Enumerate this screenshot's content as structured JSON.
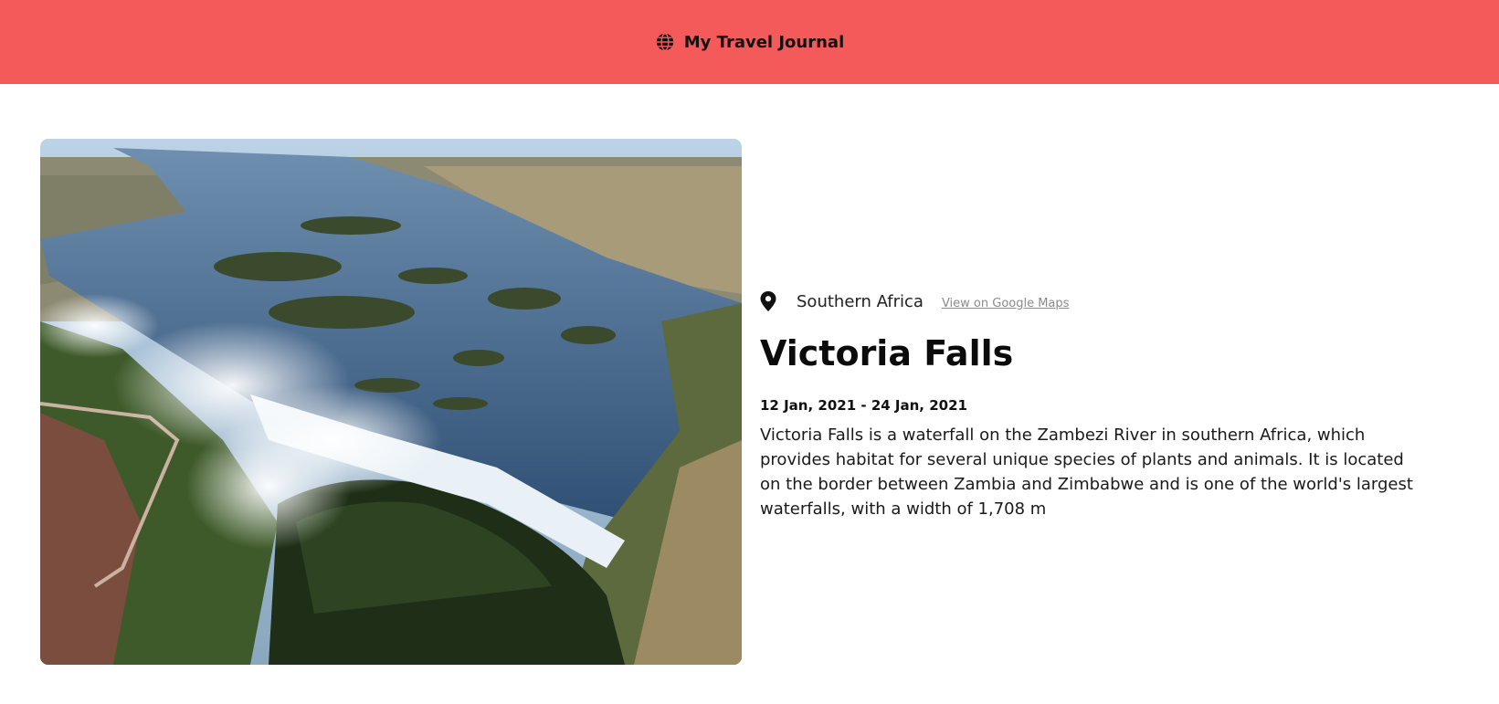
{
  "header": {
    "icon": "globe-icon",
    "title": "My Travel Journal",
    "background_color": "#f55a5a"
  },
  "entry": {
    "image_alt": "Victoria Falls",
    "location_icon": "map-pin-icon",
    "location": "Southern Africa",
    "maps_link_label": "View on Google Maps",
    "title": "Victoria Falls",
    "dates": "12 Jan, 2021 - 24 Jan, 2021",
    "description": "Victoria Falls is a waterfall on the Zambezi River in southern Africa, which provides habitat for several unique species of plants and animals. It is located on the border between Zambia and Zimbabwe and is one of the world's largest waterfalls, with a width of 1,708 m"
  }
}
